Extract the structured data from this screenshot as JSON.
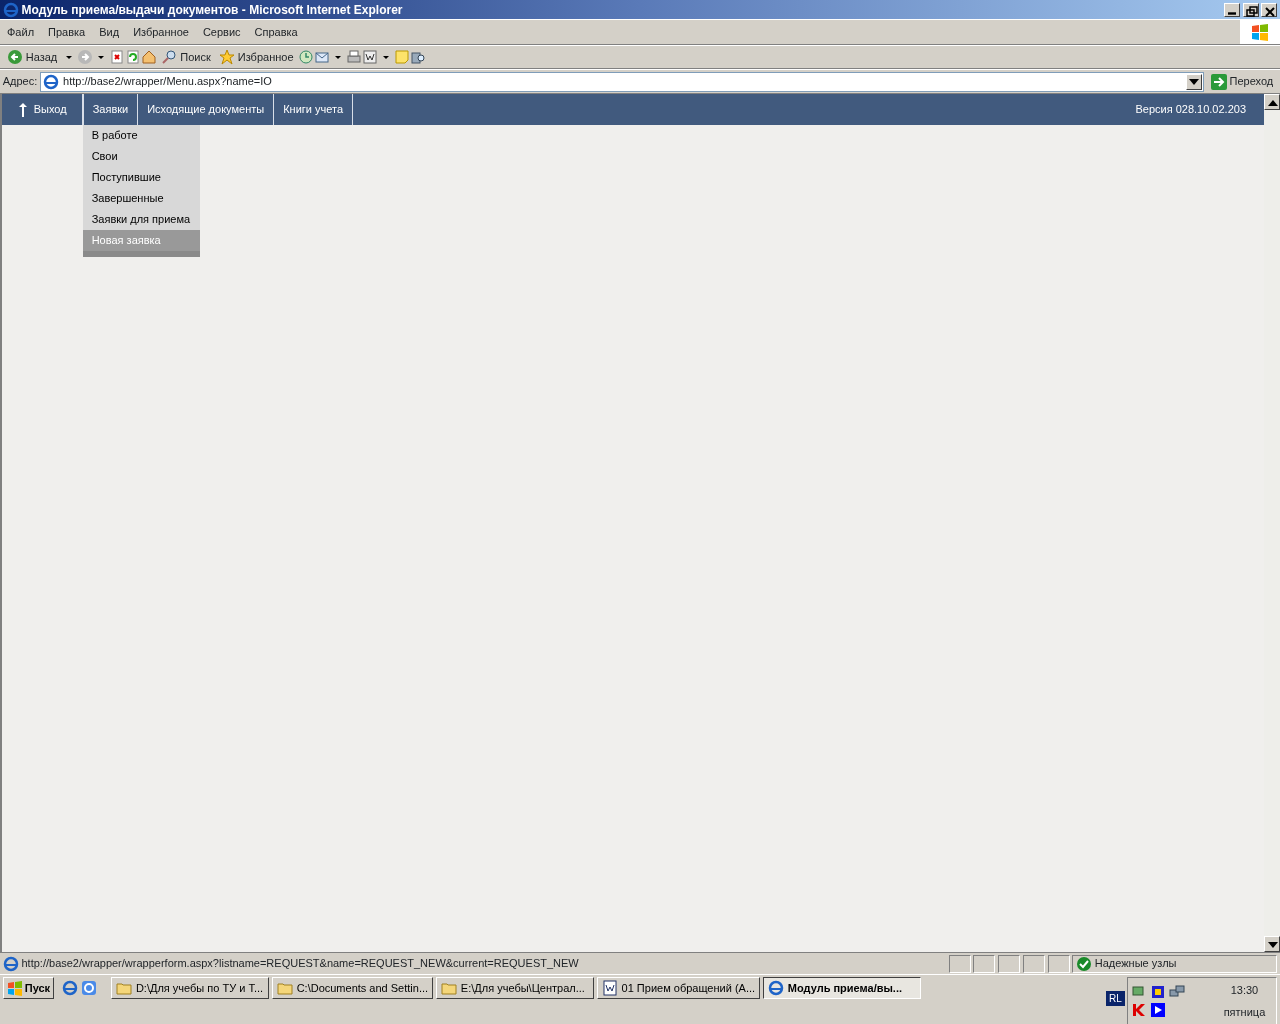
{
  "window": {
    "title": "Модуль приема/выдачи документов - Microsoft Internet Explorer"
  },
  "menu_bar": [
    "Файл",
    "Правка",
    "Вид",
    "Избранное",
    "Сервис",
    "Справка"
  ],
  "toolbar": {
    "back_label": "Назад",
    "search_label": "Поиск",
    "favorites_label": "Избранное"
  },
  "address_bar": {
    "label": "Адрес:",
    "value": "http://base2/wrapper/Menu.aspx?name=IO",
    "go_label": "Переход"
  },
  "app_nav": {
    "exit_label": "Выход",
    "version": "Версия 028.10.02.203",
    "tabs": [
      {
        "label": "Заявки",
        "expanded": true
      },
      {
        "label": "Исходящие документы",
        "expanded": false
      },
      {
        "label": "Книги учета",
        "expanded": false
      }
    ]
  },
  "dropdown": [
    {
      "label": "В работе",
      "selected": false
    },
    {
      "label": "Свои",
      "selected": false
    },
    {
      "label": "Поступившие",
      "selected": false
    },
    {
      "label": "Завершенные",
      "selected": false
    },
    {
      "label": "Заявки для приема",
      "selected": false
    },
    {
      "label": "Новая заявка",
      "selected": true
    }
  ],
  "status_bar": {
    "url": "http://base2/wrapper/wrapperform.aspx?listname=REQUEST&name=REQUEST_NEW&current=REQUEST_NEW",
    "zone": "Надежные узлы"
  },
  "taskbar": {
    "start": "Пуск",
    "tasks": [
      {
        "label": "D:\\Для учебы по ТУ и Т...",
        "kind": "folder",
        "selected": false
      },
      {
        "label": "C:\\Documents and Settin...",
        "kind": "folder",
        "selected": false
      },
      {
        "label": "E:\\Для учебы\\Централ...",
        "kind": "folder",
        "selected": false
      },
      {
        "label": "01 Прием обращений (А...",
        "kind": "word",
        "selected": false
      },
      {
        "label": "Модуль приема/вы...",
        "kind": "ie",
        "selected": true
      }
    ],
    "language": "RL",
    "time": "13:30",
    "day": "пятница"
  }
}
